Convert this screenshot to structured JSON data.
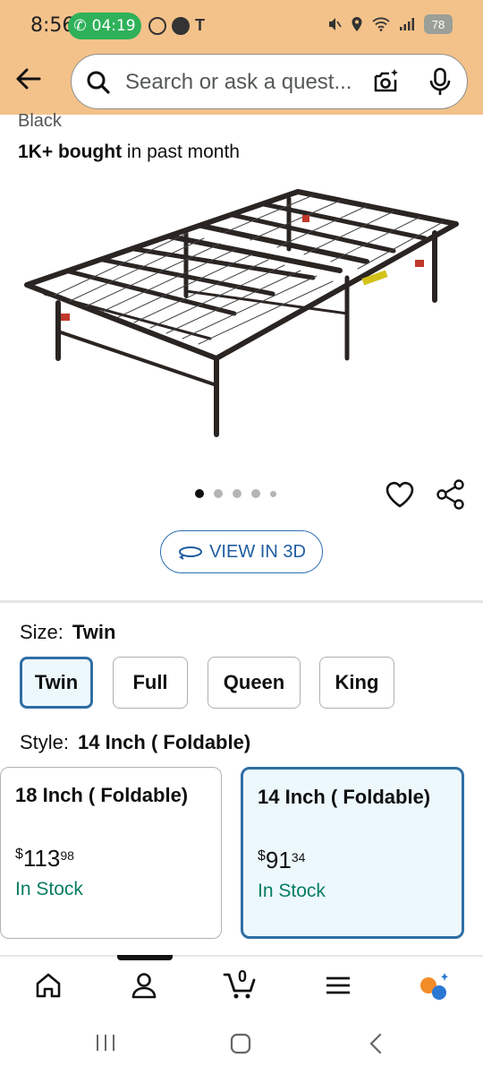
{
  "status_bar": {
    "time": "8:56",
    "call_timer": "04:19",
    "carrier_glyph": "T",
    "battery": "78"
  },
  "search": {
    "placeholder": "Search or ask a quest..."
  },
  "product": {
    "color_partial": "Black",
    "bought_bold": "1K+ bought",
    "bought_rest": " in past month",
    "image_dots": 5,
    "active_dot": 0,
    "view3d_label": "VIEW IN 3D"
  },
  "size": {
    "label": "Size:",
    "selected": "Twin",
    "options": [
      "Twin",
      "Full",
      "Queen",
      "King"
    ]
  },
  "style": {
    "label": "Style:",
    "selected": "14 Inch ( Foldable)",
    "cards": [
      {
        "title": "18 Inch ( Foldable)",
        "currency": "$",
        "price_whole": "113",
        "price_fraction": "98",
        "stock": "In Stock"
      },
      {
        "title": "14 Inch ( Foldable)",
        "currency": "$",
        "price_whole": "91",
        "price_fraction": "34",
        "stock": "In Stock"
      }
    ]
  },
  "bottom_nav": {
    "cart_count": "0",
    "items": [
      "home-icon",
      "account-icon",
      "cart-icon",
      "menu-icon",
      "rufus-icon"
    ]
  },
  "colors": {
    "header_bg": "#f3c28a",
    "selected_border": "#2f6ea5",
    "selected_bg": "#edf8fd",
    "in_stock": "#067d62",
    "link_blue": "#1f5da0"
  }
}
